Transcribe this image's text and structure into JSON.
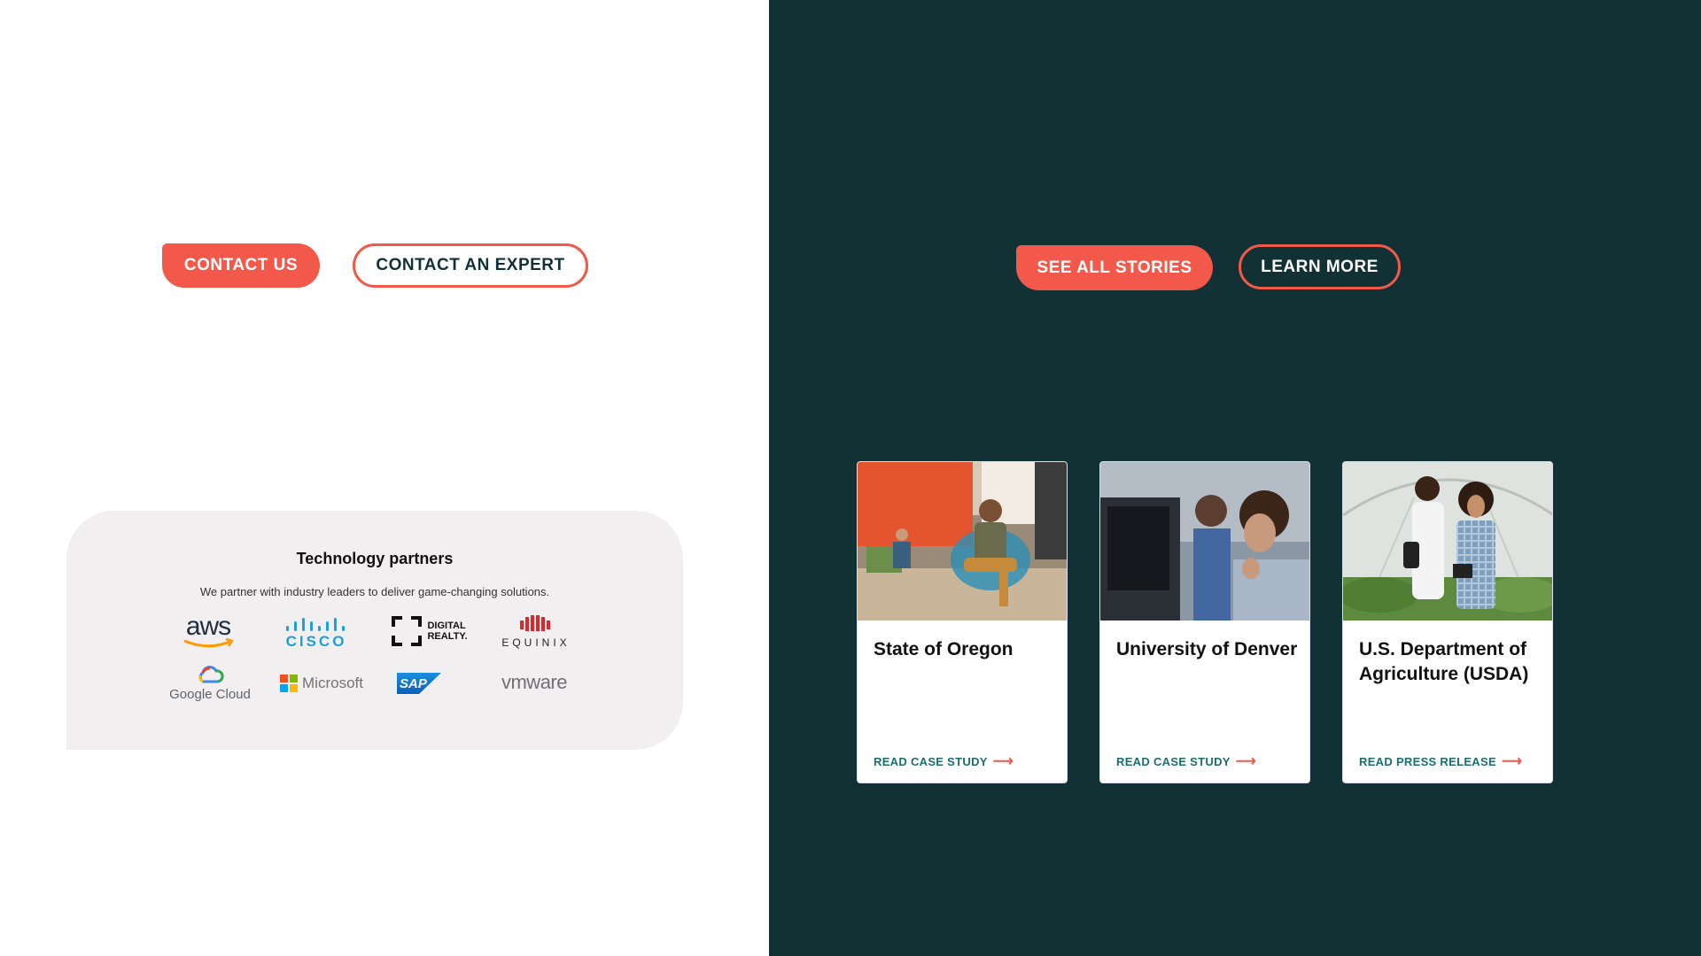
{
  "left": {
    "buttons": {
      "contact_us": "CONTACT US",
      "contact_expert": "CONTACT AN EXPERT"
    },
    "partners": {
      "title": "Technology partners",
      "subtitle": "We partner with industry leaders to deliver game-changing solutions.",
      "logos": {
        "aws": "aws",
        "cisco": "CISCO",
        "digital_realty_1": "DIGITAL",
        "digital_realty_2": "REALTY.",
        "equinix": "EQUINIX",
        "google_cloud": "Google Cloud",
        "microsoft": "Microsoft",
        "sap": "SAP",
        "vmware": "vmware"
      }
    }
  },
  "right": {
    "buttons": {
      "see_all_stories": "SEE ALL STORIES",
      "learn_more": "LEARN MORE"
    },
    "cards": [
      {
        "title": "State of Oregon",
        "link": "READ CASE STUDY"
      },
      {
        "title": "University of Denver",
        "link": "READ CASE STUDY"
      },
      {
        "title": "U.S. Department of Agriculture (USDA)",
        "link": "READ PRESS RELEASE"
      }
    ]
  },
  "colors": {
    "accent": "#f2594b",
    "dark_panel": "#123135",
    "link_teal": "#1a6e70",
    "partners_bg": "#f1efef"
  }
}
